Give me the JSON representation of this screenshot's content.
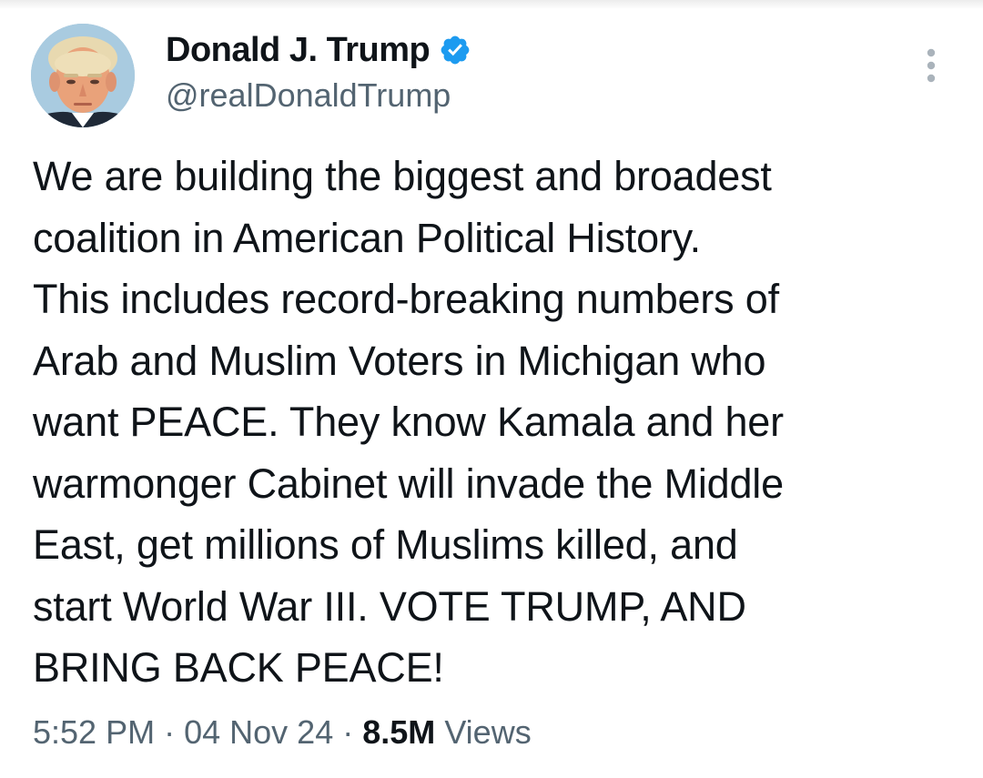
{
  "author": {
    "display_name": "Donald J. Trump",
    "handle": "@realDonaldTrump",
    "verified_color": "#1d9bf0"
  },
  "tweet": {
    "lines": [
      "We are building the biggest and broadest",
      "coalition in American Political History.",
      "This includes record-breaking numbers of",
      "Arab and Muslim Voters in Michigan who",
      "want PEACE. They know Kamala and her",
      "warmonger Cabinet will invade the Middle",
      "East, get millions of Muslims killed, and",
      "start World War III. VOTE TRUMP, AND",
      "BRING BACK PEACE!"
    ]
  },
  "meta": {
    "time": "5:52 PM",
    "separator": "·",
    "date": "04 Nov 24",
    "views_count": "8.5M",
    "views_label": "Views"
  },
  "icons": {
    "verified": "verified-badge-icon",
    "more": "more-options-icon"
  }
}
